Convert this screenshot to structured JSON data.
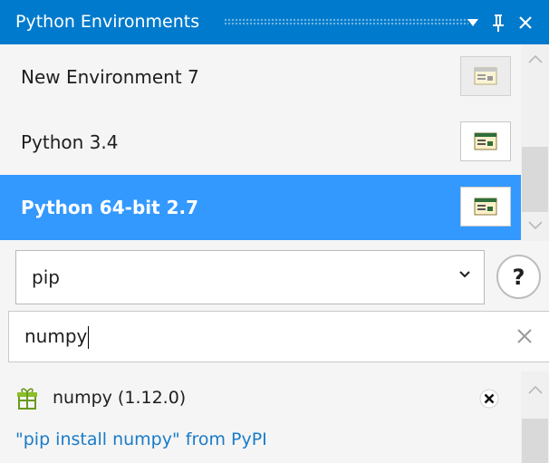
{
  "window": {
    "title": "Python Environments",
    "accent_color": "#007acc",
    "selection_color": "#3399ff",
    "buttons": [
      "dropdown-arrow-icon",
      "pin-icon",
      "close-icon"
    ]
  },
  "environments": [
    {
      "name": "New Environment 7",
      "selected": false,
      "icon": "environment-properties-icon"
    },
    {
      "name": "Python 3.4",
      "selected": false,
      "icon": "environment-properties-icon"
    },
    {
      "name": "Python 64-bit 2.7",
      "selected": true,
      "icon": "environment-properties-icon"
    }
  ],
  "package_manager": {
    "selected": "pip",
    "help_label": "?"
  },
  "search": {
    "value": "numpy"
  },
  "results": {
    "package": {
      "label": "numpy (1.12.0)",
      "icon": "package-gift-icon",
      "action_icon": "uninstall-x-icon"
    },
    "install_command": "\"pip install numpy\" from PyPI",
    "link_color": "#1a7bc7"
  }
}
